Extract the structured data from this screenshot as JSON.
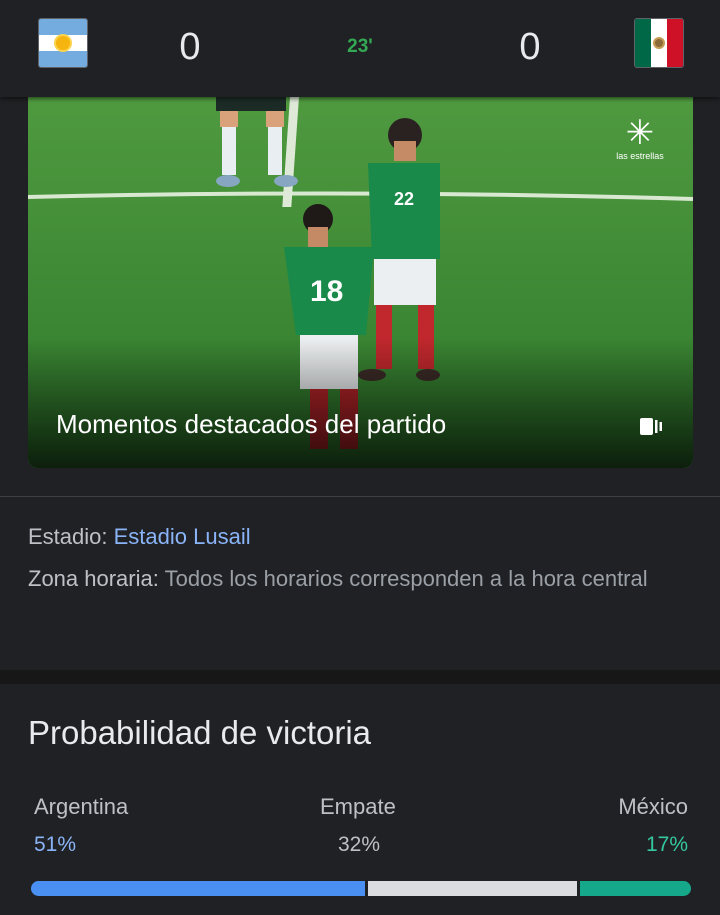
{
  "match": {
    "home_team_flag": "argentina-flag",
    "away_team_flag": "mexico-flag",
    "home_score": "0",
    "away_score": "0",
    "minute": "23'"
  },
  "highlights": {
    "title": "Momentos destacados del partido",
    "broadcaster_logo_text": "las estrellas",
    "short_icon": "shorts-icon"
  },
  "info": {
    "stadium_label": "Estadio:",
    "stadium_value": "Estadio Lusail",
    "timezone_label": "Zona horaria:",
    "timezone_value": "Todos los horarios corresponden a la hora central"
  },
  "probability": {
    "title": "Probabilidad de victoria",
    "home_label": "Argentina",
    "draw_label": "Empate",
    "away_label": "México",
    "home_value": "51%",
    "draw_value": "32%",
    "away_value": "17%",
    "home_pct": 51,
    "draw_pct": 32,
    "away_pct": 17
  },
  "colors": {
    "minute": "#34a853",
    "link": "#8ab4f8",
    "home_bar": "#4a90f2",
    "draw_bar": "#dadce0",
    "away_bar": "#15a88a"
  }
}
